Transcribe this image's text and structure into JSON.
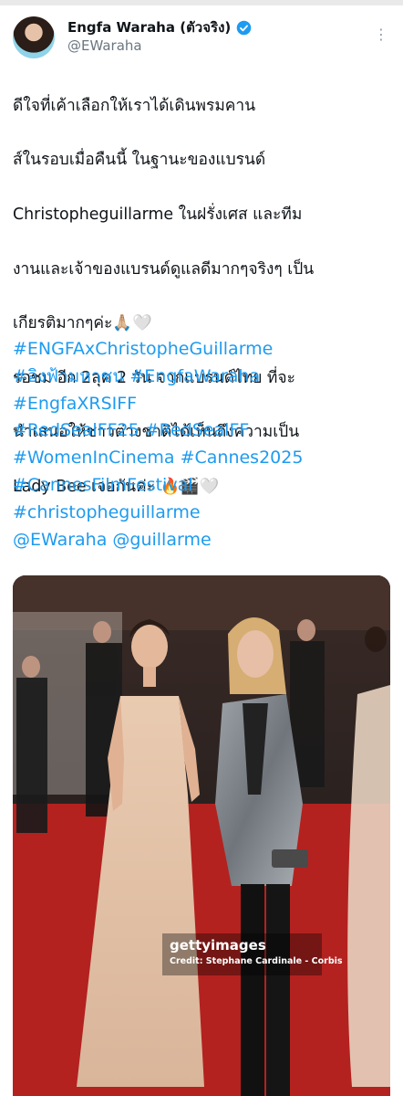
{
  "post": {
    "display_name": "Engfa Waraha (ตัวจริง)",
    "handle": "@EWaraha",
    "more_glyph": "⋮",
    "body_lines": [
      "ดีใจที่เค้าเลือกให้เราได้เดินพรมคาน",
      "ส์ในรอบเมื่อคืนนี้ ในฐานะของแบรนด์",
      "Christopheguillarme ในฝรั่งเศส  และทีม",
      "งานและเจ้าของแบรนด์ดูแลดีมากๆจริงๆ เป็น",
      "เกียรติมากๆค่ะ🙏🏼🤍",
      "รอชม อีก 2ลุค 2 วัน จากแบรนด์ไทย ที่จะ",
      "นำเสนอให้ชาวต่างชาติได้เห็นถึงความเป็น",
      "Lady Bee เจอกันค่ะ 🔥🎬🤍"
    ],
    "hashtag_lines": [
      "#ENGFAxChristopheGuillarme",
      "#อิงฟ้ามหาชน #EngfaWaraha",
      "#EngfaXRSIFF",
      "#RedSealFF25 #RedSealFF",
      "#WomenInCinema #Cannes2025",
      "#CannesFilmFestival",
      "#christopheguillarme",
      "@EWaraha @guillarme"
    ]
  },
  "photo": {
    "watermark_logo": "gettyimages",
    "watermark_credit": "Credit: Stephane Cardinale - Corbis"
  },
  "colors": {
    "link": "#1d9bf0",
    "verified": "#1d9bf0",
    "text": "#0f1419",
    "secondary": "#6b7680",
    "carpet": "#b3221f"
  }
}
